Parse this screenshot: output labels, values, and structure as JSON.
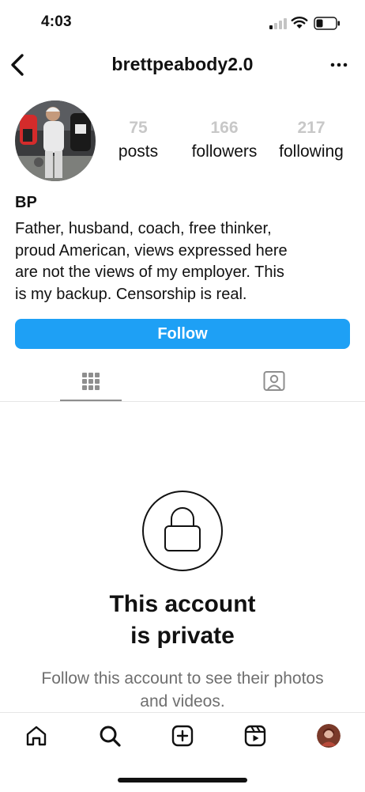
{
  "status_bar": {
    "time": "4:03",
    "icons": [
      "cellular-signal-icon",
      "wifi-icon",
      "battery-icon"
    ]
  },
  "header": {
    "username": "brettpeabody2.0",
    "back_icon": "chevron-left-icon",
    "more_icon": "ellipsis-icon"
  },
  "profile": {
    "stats": {
      "posts": {
        "value": "75",
        "label": "posts"
      },
      "followers": {
        "value": "166",
        "label": "followers"
      },
      "following": {
        "value": "217",
        "label": "following"
      }
    },
    "display_name": "BP",
    "bio": "Father, husband, coach, free thinker,\nproud American, views expressed here\nare not the views of my employer. This\nis my backup. Censorship is real.",
    "follow_label": "Follow"
  },
  "tabs": [
    {
      "icon": "grid-icon",
      "selected": true
    },
    {
      "icon": "tagged-person-icon",
      "selected": false
    }
  ],
  "private_notice": {
    "title": "This account\nis private",
    "subtitle": "Follow this account to see their photos and videos."
  },
  "bottom_nav": [
    "home-icon",
    "search-icon",
    "create-icon",
    "reels-icon",
    "profile-avatar"
  ],
  "colors": {
    "accent": "#1ea0f5",
    "muted_text": "#6f6f6f",
    "stat_numbers": "#c8c8c8"
  }
}
